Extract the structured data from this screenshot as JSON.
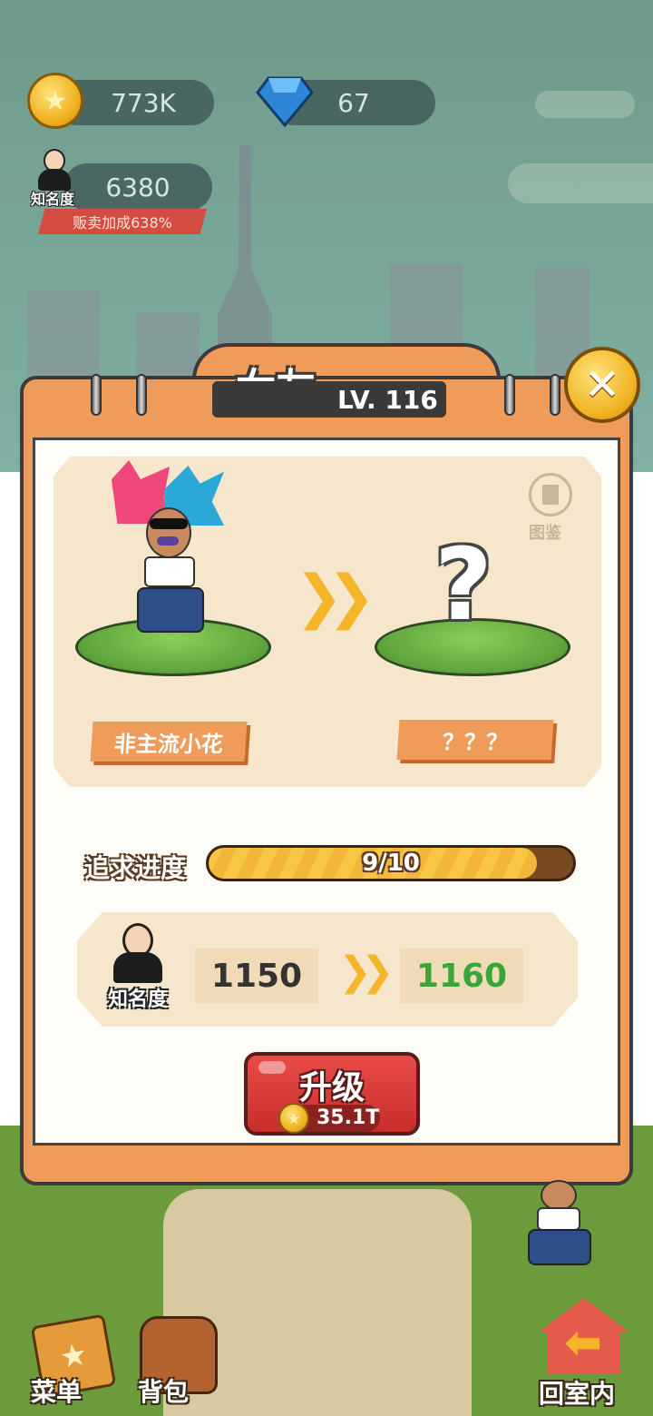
{
  "resources": {
    "coins": "773K",
    "gems": "67",
    "fame_label": "知名度",
    "fame_value": "6380",
    "sales_bonus": "贩卖加成638%"
  },
  "panel": {
    "title": "女友",
    "level": "LV. 116",
    "encyclopedia_label": "图鉴",
    "current_name": "非主流小花",
    "next_name": "？？？",
    "progress_label": "追求进度",
    "progress_text": "9/10",
    "progress_value": 0.9,
    "fame_label": "知名度",
    "fame_current": "1150",
    "fame_next": "1160",
    "upgrade_label": "升级",
    "upgrade_cost": "35.1T"
  },
  "bottom_nav": {
    "menu_label": "菜单",
    "backpack_label": "背包",
    "home_label": "回室内"
  },
  "colors": {
    "panel_orange": "#ef9b5a",
    "progress_fill": "#f7c743",
    "next_value_green": "#3aa63a",
    "button_red": "#d63a38"
  }
}
